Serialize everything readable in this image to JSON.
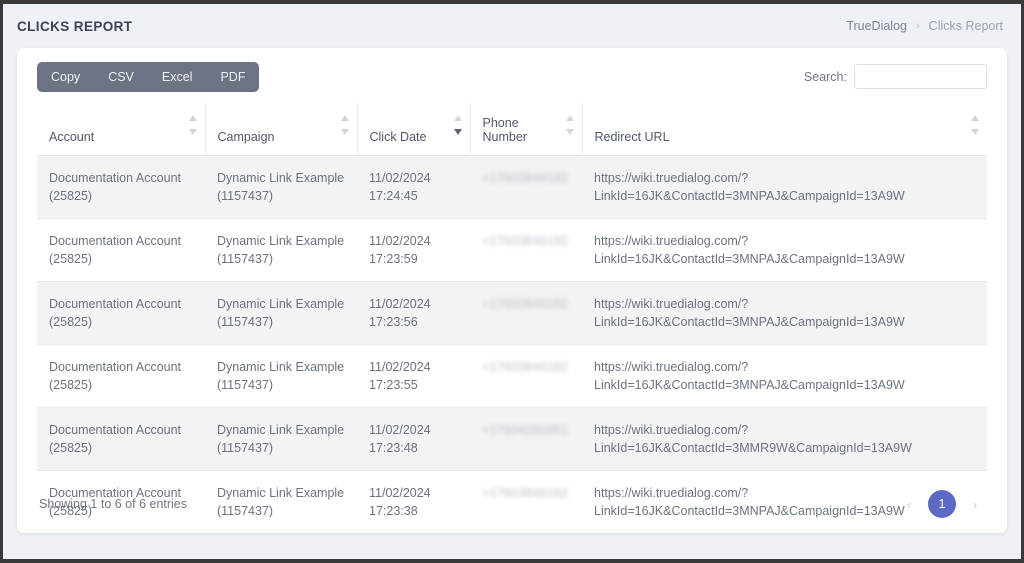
{
  "header": {
    "title": "CLICKS REPORT",
    "breadcrumb": {
      "root": "TrueDialog",
      "separator": "›",
      "current": "Clicks Report"
    }
  },
  "toolbar": {
    "export_buttons": [
      {
        "label": "Copy"
      },
      {
        "label": "CSV"
      },
      {
        "label": "Excel"
      },
      {
        "label": "PDF"
      }
    ],
    "search": {
      "label": "Search:",
      "value": "",
      "placeholder": ""
    }
  },
  "table": {
    "columns": [
      {
        "label": "Account",
        "sort": "none"
      },
      {
        "label": "Campaign",
        "sort": "none"
      },
      {
        "label": "Click Date",
        "sort": "desc"
      },
      {
        "label": "Phone Number",
        "sort": "none"
      },
      {
        "label": "Redirect URL",
        "sort": "none"
      }
    ],
    "rows": [
      {
        "account_name": "Documentation Account",
        "account_id": "(25825)",
        "campaign_name": "Dynamic Link Example",
        "campaign_id": "(1157437)",
        "click_date": "11/02/2024",
        "click_time": "17:24:45",
        "phone_number": "+17603846182",
        "url_base": "https://wiki.truedialog.com/?",
        "url_query": "LinkId=16JK&ContactId=3MNPAJ&CampaignId=13A9W"
      },
      {
        "account_name": "Documentation Account",
        "account_id": "(25825)",
        "campaign_name": "Dynamic Link Example",
        "campaign_id": "(1157437)",
        "click_date": "11/02/2024",
        "click_time": "17:23:59",
        "phone_number": "+17603846182",
        "url_base": "https://wiki.truedialog.com/?",
        "url_query": "LinkId=16JK&ContactId=3MNPAJ&CampaignId=13A9W"
      },
      {
        "account_name": "Documentation Account",
        "account_id": "(25825)",
        "campaign_name": "Dynamic Link Example",
        "campaign_id": "(1157437)",
        "click_date": "11/02/2024",
        "click_time": "17:23:56",
        "phone_number": "+17603846182",
        "url_base": "https://wiki.truedialog.com/?",
        "url_query": "LinkId=16JK&ContactId=3MNPAJ&CampaignId=13A9W"
      },
      {
        "account_name": "Documentation Account",
        "account_id": "(25825)",
        "campaign_name": "Dynamic Link Example",
        "campaign_id": "(1157437)",
        "click_date": "11/02/2024",
        "click_time": "17:23:55",
        "phone_number": "+17603846182",
        "url_base": "https://wiki.truedialog.com/?",
        "url_query": "LinkId=16JK&ContactId=3MNPAJ&CampaignId=13A9W"
      },
      {
        "account_name": "Documentation Account",
        "account_id": "(25825)",
        "campaign_name": "Dynamic Link Example",
        "campaign_id": "(1157437)",
        "click_date": "11/02/2024",
        "click_time": "17:23:48",
        "phone_number": "+17604280951",
        "url_base": "https://wiki.truedialog.com/?",
        "url_query": "LinkId=16JK&ContactId=3MMR9W&CampaignId=13A9W"
      },
      {
        "account_name": "Documentation Account",
        "account_id": "(25825)",
        "campaign_name": "Dynamic Link Example",
        "campaign_id": "(1157437)",
        "click_date": "11/02/2024",
        "click_time": "17:23:38",
        "phone_number": "+17603846182",
        "url_base": "https://wiki.truedialog.com/?",
        "url_query": "LinkId=16JK&ContactId=3MNPAJ&CampaignId=13A9W"
      }
    ]
  },
  "footer": {
    "entries_info": "Showing 1 to 6 of 6 entries",
    "pagination": {
      "prev_icon": "‹",
      "next_icon": "›",
      "pages": [
        "1"
      ],
      "active_page": "1"
    }
  },
  "colors": {
    "page_background": "#eef1f5",
    "card_background": "#ffffff",
    "export_bar": "#6c7382",
    "pagination_active": "#5c6ac4",
    "row_stripe": "#f1f3f4",
    "text_primary": "#3c4257",
    "text_muted": "#6b7280"
  }
}
